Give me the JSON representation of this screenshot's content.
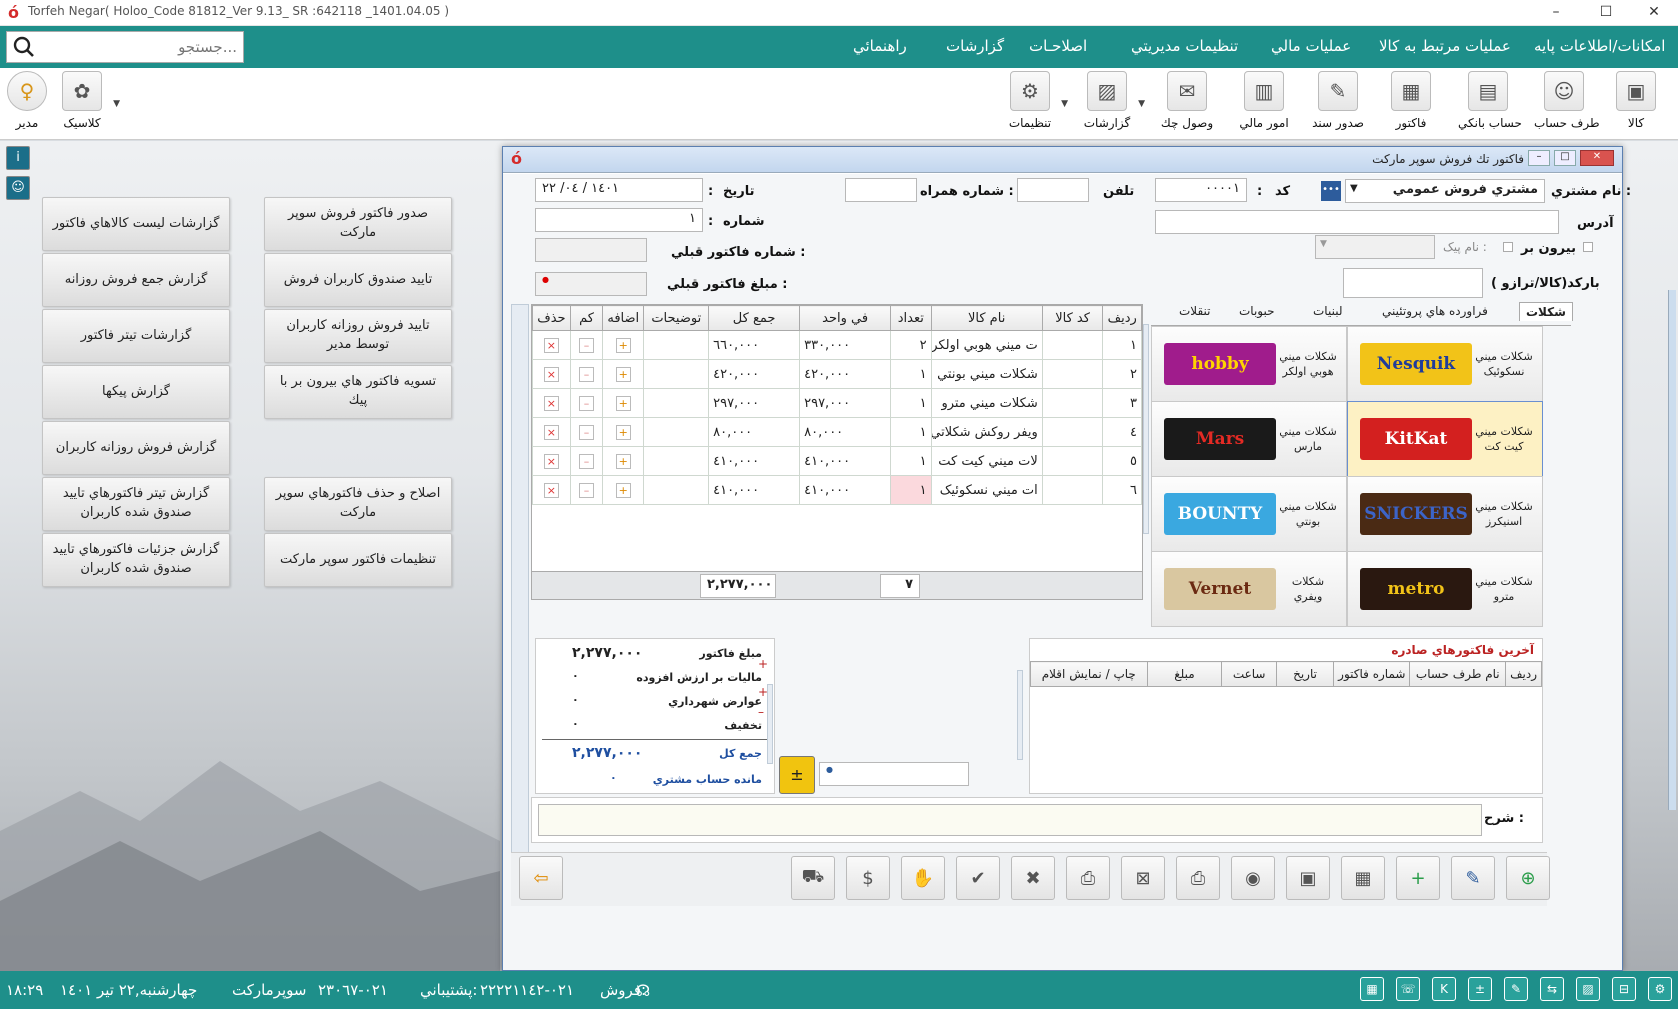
{
  "window": {
    "title": "Torfeh Negar( Holoo_Code  81812_Ver 9.13_ SR :642118 _1401.04.05 )"
  },
  "menu": [
    "امكانات/اطلاعات پايه",
    "عمليات مرتبط به كالا",
    "عمليات مالي",
    "تنظيمات مديريتي",
    "اصلاحـات",
    "گزارشات",
    "راهنمائي"
  ],
  "search": {
    "placeholder": "جستجو..."
  },
  "toolbar": {
    "items": [
      "كالا",
      "طرف حساب",
      "حساب بانكي",
      "فاكتور",
      "صدور سند",
      "امور مالي",
      "وصول چك",
      "گزارشات",
      "تنظيمات"
    ],
    "right_items": [
      "كلاسيک",
      "مدير"
    ]
  },
  "desk": {
    "right_col": [
      "صدور فاكتور فروش سوپر ماركت",
      "تاييد صندوق كاربران فروش",
      "تاييد فروش روزانه كاربران توسط مدير",
      "تسويه فاكتور هاي بيرون بر با پيك",
      "اصلاح و حذف فاكتورهاي سوپر ماركت",
      "تنظيمات فاكتور سوپر ماركت"
    ],
    "left_col": [
      "گزارشات ليست كالاهاي فاكتور",
      "گزارش جمع فروش روزانه",
      "گزارشات تيتر فاكتور",
      "گزارش پيكها",
      "گزارش فروش روزانه كاربران",
      "گزارش تيتر فاكتورهاي تاييد صندوق شده كاربران",
      "گزارش جزئيات فاكتورهاي تاييد صندوق شده كاربران"
    ]
  },
  "invoice": {
    "title": "فاكتور تك فروش سوپر ماركت",
    "labels": {
      "customer": "نام مشتري :",
      "code": "كد",
      "phone": "تلفن",
      "mobile": "شماره همراه :",
      "date": "تاريخ",
      "address": "آدرس",
      "number": "شماره",
      "outside": "بيرون بر",
      "courier": "نام پيک :",
      "prev_no": "شماره فاكتور قبلي :",
      "barcode": "باركد(كالا/ترازو )",
      "prev_amount": "مبلغ فاكتور قبلي :",
      "desc": "شرح :"
    },
    "customer": "مشتري فروش عمومي",
    "code": "٠٠٠٠١",
    "date": "١٤٠١ / ٠٤/ ٢٢",
    "number": "١",
    "columns": [
      "رديف",
      "كد كالا",
      "نام كالا",
      "تعداد",
      "في واحد",
      "جمع كل",
      "توضيحات",
      "اضافه",
      "كم",
      "حذف"
    ],
    "rows": [
      {
        "n": "١",
        "name": "ت ميني هوبي اولكر",
        "qty": "٢",
        "unit": "٣٣٠,٠٠٠",
        "total": "٦٦٠,٠٠٠"
      },
      {
        "n": "٢",
        "name": "شكلات ميني بونتي",
        "qty": "١",
        "unit": "٤٢٠,٠٠٠",
        "total": "٤٢٠,٠٠٠"
      },
      {
        "n": "٣",
        "name": "شكلات ميني مترو",
        "qty": "١",
        "unit": "٢٩٧,٠٠٠",
        "total": "٢٩٧,٠٠٠"
      },
      {
        "n": "٤",
        "name": "ويفر روكش شكلاتي",
        "qty": "١",
        "unit": "٨٠,٠٠٠",
        "total": "٨٠,٠٠٠"
      },
      {
        "n": "٥",
        "name": "لات ميني كيت كت",
        "qty": "١",
        "unit": "٤١٠,٠٠٠",
        "total": "٤١٠,٠٠٠"
      },
      {
        "n": "٦",
        "name": "ات ميني نسكوئيک",
        "qty": "١",
        "unit": "٤١٠,٠٠٠",
        "total": "٤١٠,٠٠٠"
      }
    ],
    "footer": {
      "total": "٢,٢٧٧,٠٠٠",
      "count": "٧"
    },
    "tabs": [
      "شكلات",
      "فراورده هاي پروتئيني",
      "لبنيات",
      "حبوبات",
      "تنقلات"
    ],
    "products": [
      {
        "name": "شكلات ميني نسكوئيک",
        "brand": "Nesquik",
        "bg": "#f2c318",
        "fg": "#1f3c9b"
      },
      {
        "name": "شكلات ميني هوبي اولكر",
        "brand": "hobby",
        "bg": "#a01c8c",
        "fg": "#ffd400"
      },
      {
        "name": "شكلات ميني كيت كت",
        "brand": "KitKat",
        "bg": "#d3201f",
        "fg": "#ffffff"
      },
      {
        "name": "شكلات ميني مارس",
        "brand": "Mars",
        "bg": "#1a1a1a",
        "fg": "#e42a24"
      },
      {
        "name": "شكلات ميني اسنيكرز",
        "brand": "SNICKERS",
        "bg": "#4a2a14",
        "fg": "#3c64c8"
      },
      {
        "name": "شكلات ميني بونتي",
        "brand": "BOUNTY",
        "bg": "#3aa8e0",
        "fg": "#ffffff"
      },
      {
        "name": "شكلات ميني مترو",
        "brand": "metro",
        "bg": "#2a1810",
        "fg": "#f2c318"
      },
      {
        "name": "شكلات ويفري",
        "brand": "Vernet",
        "bg": "#d9c7a0",
        "fg": "#6b2a12"
      }
    ],
    "summary": {
      "labels": [
        "مبلغ فاكتور",
        "ماليات بر ارزش افزوده",
        "عوارض شهرداري",
        "تخفيف",
        "جمع كل",
        "مانده حساب مشتري"
      ],
      "values": [
        "٢,٢٧٧,٠٠٠",
        "٠",
        "٠",
        "٠",
        "٢,٢٧٧,٠٠٠",
        "٠"
      ]
    },
    "last_title": "آخرين فاكتورهاي صادره",
    "last_columns": [
      "رديف",
      "نام طرف حساب",
      "شماره فاكتور",
      "تاريخ",
      "ساعت",
      "مبلغ",
      "چاپ / نمايش اقلام"
    ]
  },
  "status": {
    "sales": "فروش:",
    "sales_phone": "٠٢١-٢٢٢٢١١٤٢",
    "support": "پشتيباني:",
    "support_phone": "٠٢١-٢٣٠٦٧",
    "mode": "سوپرماركت",
    "date": "چهارشنبه,٢٢ تير ١٤٠١",
    "time": "١٨:٢٩"
  }
}
